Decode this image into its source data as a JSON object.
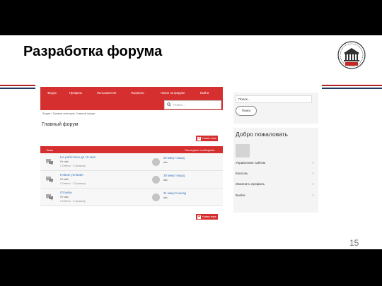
{
  "slide": {
    "title": "Разработка форума",
    "page_number": "15",
    "colors": {
      "stripe_red": "#b22222",
      "stripe_navy": "#1f3b63",
      "accent": "#d62f2f"
    },
    "logo_icon": "university-emblem"
  },
  "forum": {
    "navbar": [
      "Форум",
      "Профиль",
      "Пользователи",
      "Подписки",
      "Новое на форуме",
      "Выйти"
    ],
    "search_placeholder": "Поиск ...",
    "breadcrumb": "Форум  >  Пример категории: Главный форум",
    "forum_title": "Главный форум",
    "new_topic_label": "Новая тема",
    "table_headers": {
      "topics": "Темы",
      "last_post": "Последнее сообщение"
    },
    "topics": [
      {
        "title": "Не работаем до 10 мая",
        "author": "От adc",
        "stats": "0 Ответы · 1 Просмотр",
        "last_time": "29 минут назад",
        "last_by": "adc"
      },
      {
        "title": "Новые условия",
        "author": "От adc",
        "stats": "0 Ответы · 1 Просмотр",
        "last_time": "30 минут назад",
        "last_by": "adc"
      },
      {
        "title": "Отзывы",
        "author": "От adc",
        "stats": "0 Ответы · 1 Просмотр",
        "last_time": "31 минута назад",
        "last_by": "adc"
      }
    ]
  },
  "sidebar": {
    "search_placeholder": "Поиск...",
    "search_button": "Поиск",
    "welcome_title": "Добро пожаловать",
    "menu": [
      "Управление сайтом",
      "Консоль",
      "Изменить профиль",
      "Выйти"
    ]
  }
}
